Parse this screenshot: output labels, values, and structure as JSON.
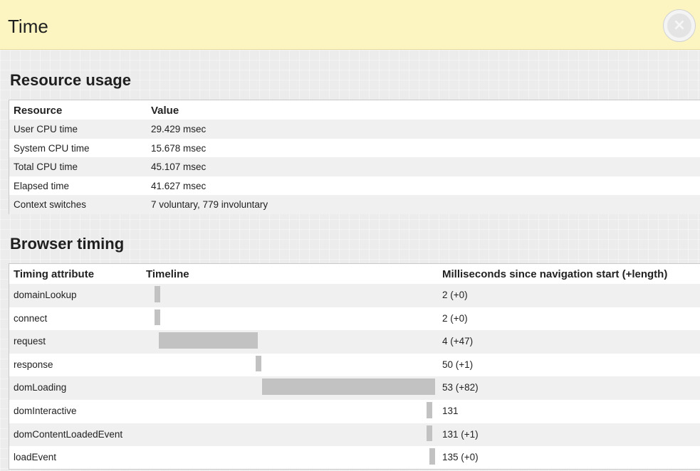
{
  "window": {
    "title": "Time",
    "close_icon": "close-circle-icon"
  },
  "resource_usage": {
    "heading": "Resource usage",
    "columns": [
      "Resource",
      "Value"
    ],
    "rows": [
      {
        "resource": "User CPU time",
        "value": "29.429 msec"
      },
      {
        "resource": "System CPU time",
        "value": "15.678 msec"
      },
      {
        "resource": "Total CPU time",
        "value": "45.107 msec"
      },
      {
        "resource": "Elapsed time",
        "value": "41.627 msec"
      },
      {
        "resource": "Context switches",
        "value": "7 voluntary, 779 involuntary"
      }
    ]
  },
  "browser_timing": {
    "heading": "Browser timing",
    "columns": [
      "Timing attribute",
      "Timeline",
      "Milliseconds since navigation start (+length)"
    ],
    "timeline_total_ms": 135,
    "rows": [
      {
        "attribute": "domainLookup",
        "ms": "2 (+0)",
        "start": 2,
        "length": 0
      },
      {
        "attribute": "connect",
        "ms": "2 (+0)",
        "start": 2,
        "length": 0
      },
      {
        "attribute": "request",
        "ms": "4 (+47)",
        "start": 4,
        "length": 47
      },
      {
        "attribute": "response",
        "ms": "50 (+1)",
        "start": 50,
        "length": 1
      },
      {
        "attribute": "domLoading",
        "ms": "53 (+82)",
        "start": 53,
        "length": 82
      },
      {
        "attribute": "domInteractive",
        "ms": "131",
        "start": 131,
        "length": 0
      },
      {
        "attribute": "domContentLoadedEvent",
        "ms": "131 (+1)",
        "start": 131,
        "length": 1
      },
      {
        "attribute": "loadEvent",
        "ms": "135 (+0)",
        "start": 135,
        "length": 0
      }
    ]
  }
}
